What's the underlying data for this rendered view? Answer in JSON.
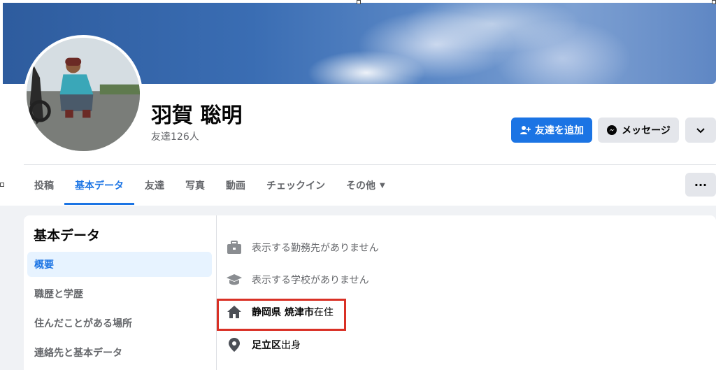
{
  "profile": {
    "name": "羽賀 聡明",
    "friends_count": "友達126人"
  },
  "actions": {
    "add_friend": "友達を追加",
    "message": "メッセージ"
  },
  "tabs": [
    {
      "label": "投稿"
    },
    {
      "label": "基本データ"
    },
    {
      "label": "友達"
    },
    {
      "label": "写真"
    },
    {
      "label": "動画"
    },
    {
      "label": "チェックイン"
    },
    {
      "label": "その他"
    }
  ],
  "sidebar": {
    "title": "基本データ",
    "items": [
      {
        "label": "概要"
      },
      {
        "label": "職歴と学歴"
      },
      {
        "label": "住んだことがある場所"
      },
      {
        "label": "連絡先と基本データ"
      }
    ]
  },
  "overview": {
    "work": "表示する勤務先がありません",
    "school": "表示する学校がありません",
    "lives_in": {
      "place": "静岡県 焼津市",
      "suffix": "在住"
    },
    "from": {
      "place": "足立区",
      "suffix": "出身"
    }
  },
  "colors": {
    "accent": "#1b74e4",
    "highlight": "#d93025"
  },
  "icons": [
    "add-friend-icon",
    "messenger-icon",
    "chevron-down-icon",
    "more-dots-icon",
    "briefcase-icon",
    "graduation-cap-icon",
    "home-icon",
    "location-pin-icon"
  ]
}
